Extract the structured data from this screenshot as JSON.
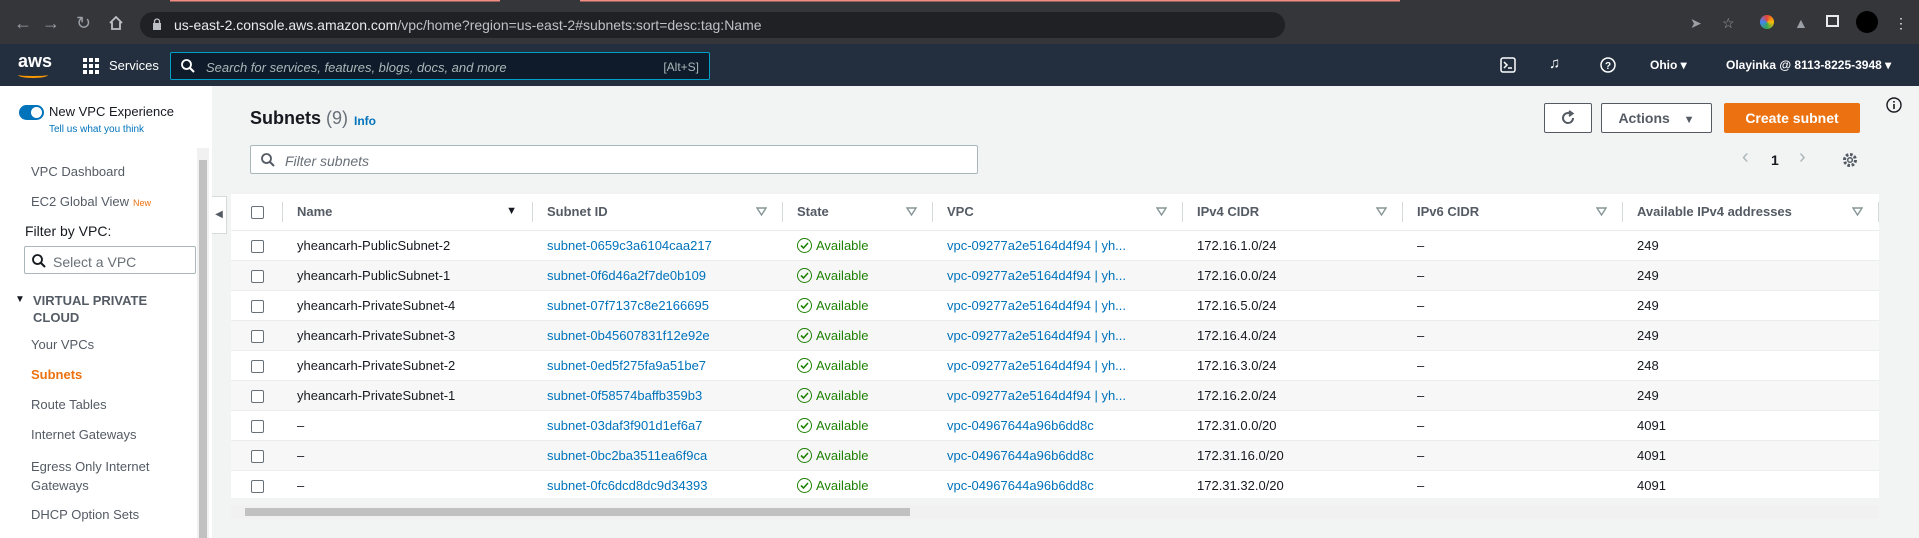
{
  "browser": {
    "url_host": "us-east-2.console.aws.amazon.com",
    "url_path": "/vpc/home?region=us-east-2#subnets:sort=desc:tag:Name"
  },
  "aws_nav": {
    "logo": "aws",
    "services_label": "Services",
    "search_placeholder": "Search for services, features, blogs, docs, and more",
    "search_shortcut": "[Alt+S]",
    "region": "Ohio",
    "account": "Olayinka @ 8113-8225-3948"
  },
  "sidebar": {
    "new_vpc_label": "New VPC Experience",
    "tell_us": "Tell us what you think",
    "dashboard": "VPC Dashboard",
    "ec2_global": "EC2 Global View",
    "new_badge": "New",
    "filter_label": "Filter by VPC:",
    "vpc_select_placeholder": "Select a VPC",
    "section_title": "VIRTUAL PRIVATE CLOUD",
    "items": [
      "Your VPCs",
      "Subnets",
      "Route Tables",
      "Internet Gateways",
      "Egress Only Internet Gateways",
      "DHCP Option Sets"
    ],
    "active_item": "Subnets"
  },
  "main": {
    "title": "Subnets",
    "count": "(9)",
    "info": "Info",
    "actions_label": "Actions",
    "create_label": "Create subnet",
    "filter_placeholder": "Filter subnets",
    "page": "1"
  },
  "table": {
    "headers": [
      "Name",
      "Subnet ID",
      "State",
      "VPC",
      "IPv4 CIDR",
      "IPv6 CIDR",
      "Available IPv4 addresses"
    ],
    "rows": [
      {
        "name": "yheancarh-PublicSubnet-2",
        "subnet_id": "subnet-0659c3a6104caa217",
        "state": "Available",
        "vpc": "vpc-09277a2e5164d4f94 | yh...",
        "ipv4": "172.16.1.0/24",
        "ipv6": "–",
        "avail": "249"
      },
      {
        "name": "yheancarh-PublicSubnet-1",
        "subnet_id": "subnet-0f6d46a2f7de0b109",
        "state": "Available",
        "vpc": "vpc-09277a2e5164d4f94 | yh...",
        "ipv4": "172.16.0.0/24",
        "ipv6": "–",
        "avail": "249"
      },
      {
        "name": "yheancarh-PrivateSubnet-4",
        "subnet_id": "subnet-07f7137c8e2166695",
        "state": "Available",
        "vpc": "vpc-09277a2e5164d4f94 | yh...",
        "ipv4": "172.16.5.0/24",
        "ipv6": "–",
        "avail": "249"
      },
      {
        "name": "yheancarh-PrivateSubnet-3",
        "subnet_id": "subnet-0b45607831f12e92e",
        "state": "Available",
        "vpc": "vpc-09277a2e5164d4f94 | yh...",
        "ipv4": "172.16.4.0/24",
        "ipv6": "–",
        "avail": "249"
      },
      {
        "name": "yheancarh-PrivateSubnet-2",
        "subnet_id": "subnet-0ed5f275fa9a51be7",
        "state": "Available",
        "vpc": "vpc-09277a2e5164d4f94 | yh...",
        "ipv4": "172.16.3.0/24",
        "ipv6": "–",
        "avail": "248"
      },
      {
        "name": "yheancarh-PrivateSubnet-1",
        "subnet_id": "subnet-0f58574baffb359b3",
        "state": "Available",
        "vpc": "vpc-09277a2e5164d4f94 | yh...",
        "ipv4": "172.16.2.0/24",
        "ipv6": "–",
        "avail": "249"
      },
      {
        "name": "–",
        "subnet_id": "subnet-03daf3f901d1ef6a7",
        "state": "Available",
        "vpc": "vpc-04967644a96b6dd8c",
        "ipv4": "172.31.0.0/20",
        "ipv6": "–",
        "avail": "4091"
      },
      {
        "name": "–",
        "subnet_id": "subnet-0bc2ba3511ea6f9ca",
        "state": "Available",
        "vpc": "vpc-04967644a96b6dd8c",
        "ipv4": "172.31.16.0/20",
        "ipv6": "–",
        "avail": "4091"
      },
      {
        "name": "–",
        "subnet_id": "subnet-0fc6dcd8dc9d34393",
        "state": "Available",
        "vpc": "vpc-04967644a96b6dd8c",
        "ipv4": "172.31.32.0/20",
        "ipv6": "–",
        "avail": "4091"
      }
    ]
  },
  "colors": {
    "aws_nav_bg": "#232f3e",
    "accent_orange": "#ec7211",
    "link_blue": "#0073bb",
    "status_green": "#1d8102"
  }
}
